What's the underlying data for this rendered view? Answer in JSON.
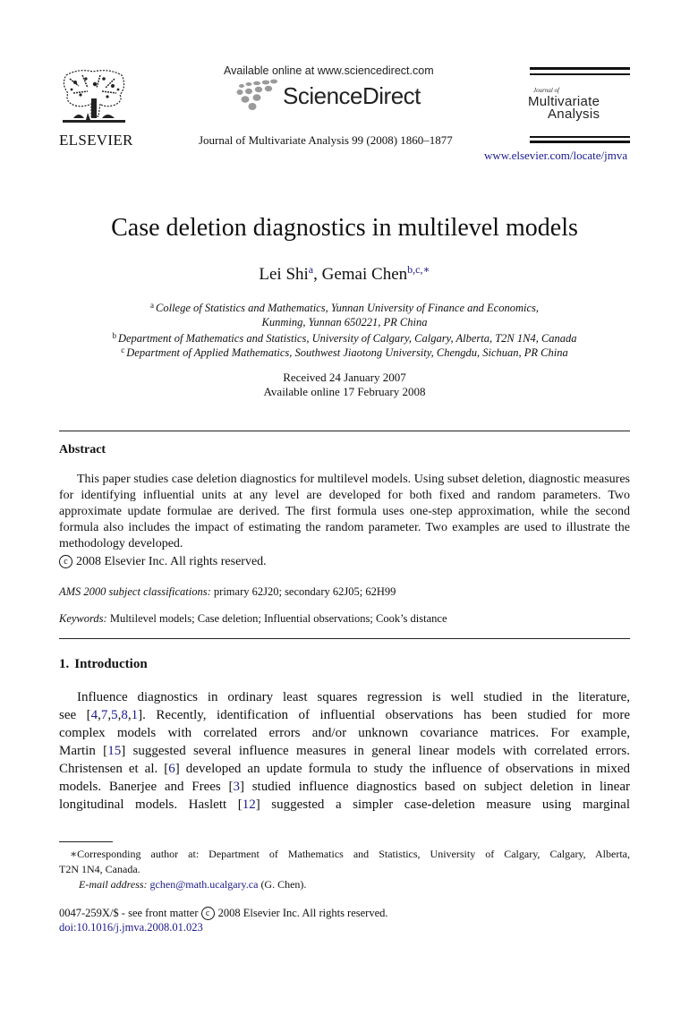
{
  "header": {
    "publisher_logo_text": "ELSEVIER",
    "sciencedirect_available": "Available online at www.sciencedirect.com",
    "sciencedirect_logo_text": "ScienceDirect",
    "journal_citation": "Journal of Multivariate Analysis 99 (2008) 1860–1877",
    "journal_logo_small": "Journal of",
    "journal_logo_line1": "Multivariate",
    "journal_logo_line2": "Analysis",
    "journal_url": "www.elsevier.com/locate/jmva"
  },
  "paper": {
    "title": "Case deletion diagnostics in multilevel models",
    "authors": [
      {
        "name": "Lei Shi",
        "sup": "a"
      },
      {
        "name": "Gemai Chen",
        "sup": "b,c,∗"
      }
    ],
    "author_separator": ", ",
    "affiliations": [
      {
        "sup": "a",
        "text": "College of Statistics and Mathematics, Yunnan University of Finance and Economics,"
      },
      {
        "sup": "",
        "text": "Kunming, Yunnan 650221, PR China"
      },
      {
        "sup": "b",
        "text": "Department of Mathematics and Statistics, University of Calgary, Calgary, Alberta, T2N 1N4, Canada"
      },
      {
        "sup": "c",
        "text": "Department of Applied Mathematics, Southwest Jiaotong University, Chengdu, Sichuan, PR China"
      }
    ],
    "received": "Received 24 January 2007",
    "available_online": "Available online 17 February 2008"
  },
  "abstract": {
    "heading": "Abstract",
    "text": "This paper studies case deletion diagnostics for multilevel models. Using subset deletion, diagnostic measures for identifying influential units at any level are developed for both fixed and random parameters. Two approximate update formulae are derived. The first formula uses one-step approximation, while the second formula also includes the impact of estimating the random parameter. Two examples are used to illustrate the methodology developed.",
    "copyright": "2008 Elsevier Inc. All rights reserved.",
    "copyright_symbol": "c"
  },
  "classification": {
    "label": "AMS 2000 subject classifications:",
    "value": " primary 62J20; secondary 62J05; 62H99"
  },
  "keywords": {
    "label": "Keywords:",
    "value": " Multilevel models; Case deletion; Influential observations; Cook’s distance"
  },
  "introduction": {
    "number": "1.",
    "heading": "Introduction",
    "lines": [
      [
        {
          "t": "Influence diagnostics in ordinary least squares regression is well studied in the literature,"
        }
      ],
      [
        {
          "t": "see ["
        },
        {
          "t": "4",
          "ref": true
        },
        {
          "t": ","
        },
        {
          "t": "7",
          "ref": true
        },
        {
          "t": ","
        },
        {
          "t": "5",
          "ref": true
        },
        {
          "t": ","
        },
        {
          "t": "8",
          "ref": true
        },
        {
          "t": ","
        },
        {
          "t": "1",
          "ref": true
        },
        {
          "t": "]. Recently, identification of influential observations has been studied for more"
        }
      ],
      [
        {
          "t": "complex models with correlated errors and/or unknown covariance matrices. For example,"
        }
      ],
      [
        {
          "t": "Martin ["
        },
        {
          "t": "15",
          "ref": true
        },
        {
          "t": "] suggested several influence measures in general linear models with correlated errors."
        }
      ],
      [
        {
          "t": "Christensen et al. ["
        },
        {
          "t": "6",
          "ref": true
        },
        {
          "t": "] developed an update formula to study the influence of observations in mixed"
        }
      ],
      [
        {
          "t": "models. Banerjee and Frees ["
        },
        {
          "t": "3",
          "ref": true
        },
        {
          "t": "] studied influence diagnostics based on subject deletion in linear"
        }
      ],
      [
        {
          "t": "longitudinal models. Haslett ["
        },
        {
          "t": "12",
          "ref": true
        },
        {
          "t": "] suggested a simpler case-deletion measure using marginal"
        }
      ]
    ]
  },
  "footnote": {
    "marker": "∗",
    "line1": "Corresponding author at: Department of Mathematics and Statistics, University of Calgary, Calgary, Alberta,",
    "line2": "T2N 1N4, Canada.",
    "email_label": "E-mail address:",
    "email": "gchen@math.ucalgary.ca",
    "email_suffix": " (G. Chen)."
  },
  "front_matter": {
    "issn_prefix": "0047-259X/$ - see front matter",
    "copyright": "2008 Elsevier Inc. All rights reserved.",
    "copyright_symbol": "c",
    "doi": "doi:10.1016/j.jmva.2008.01.023"
  },
  "colors": {
    "link": "#1a1a8a",
    "text": "#111111",
    "sd_dots": "#9a9a9a"
  }
}
